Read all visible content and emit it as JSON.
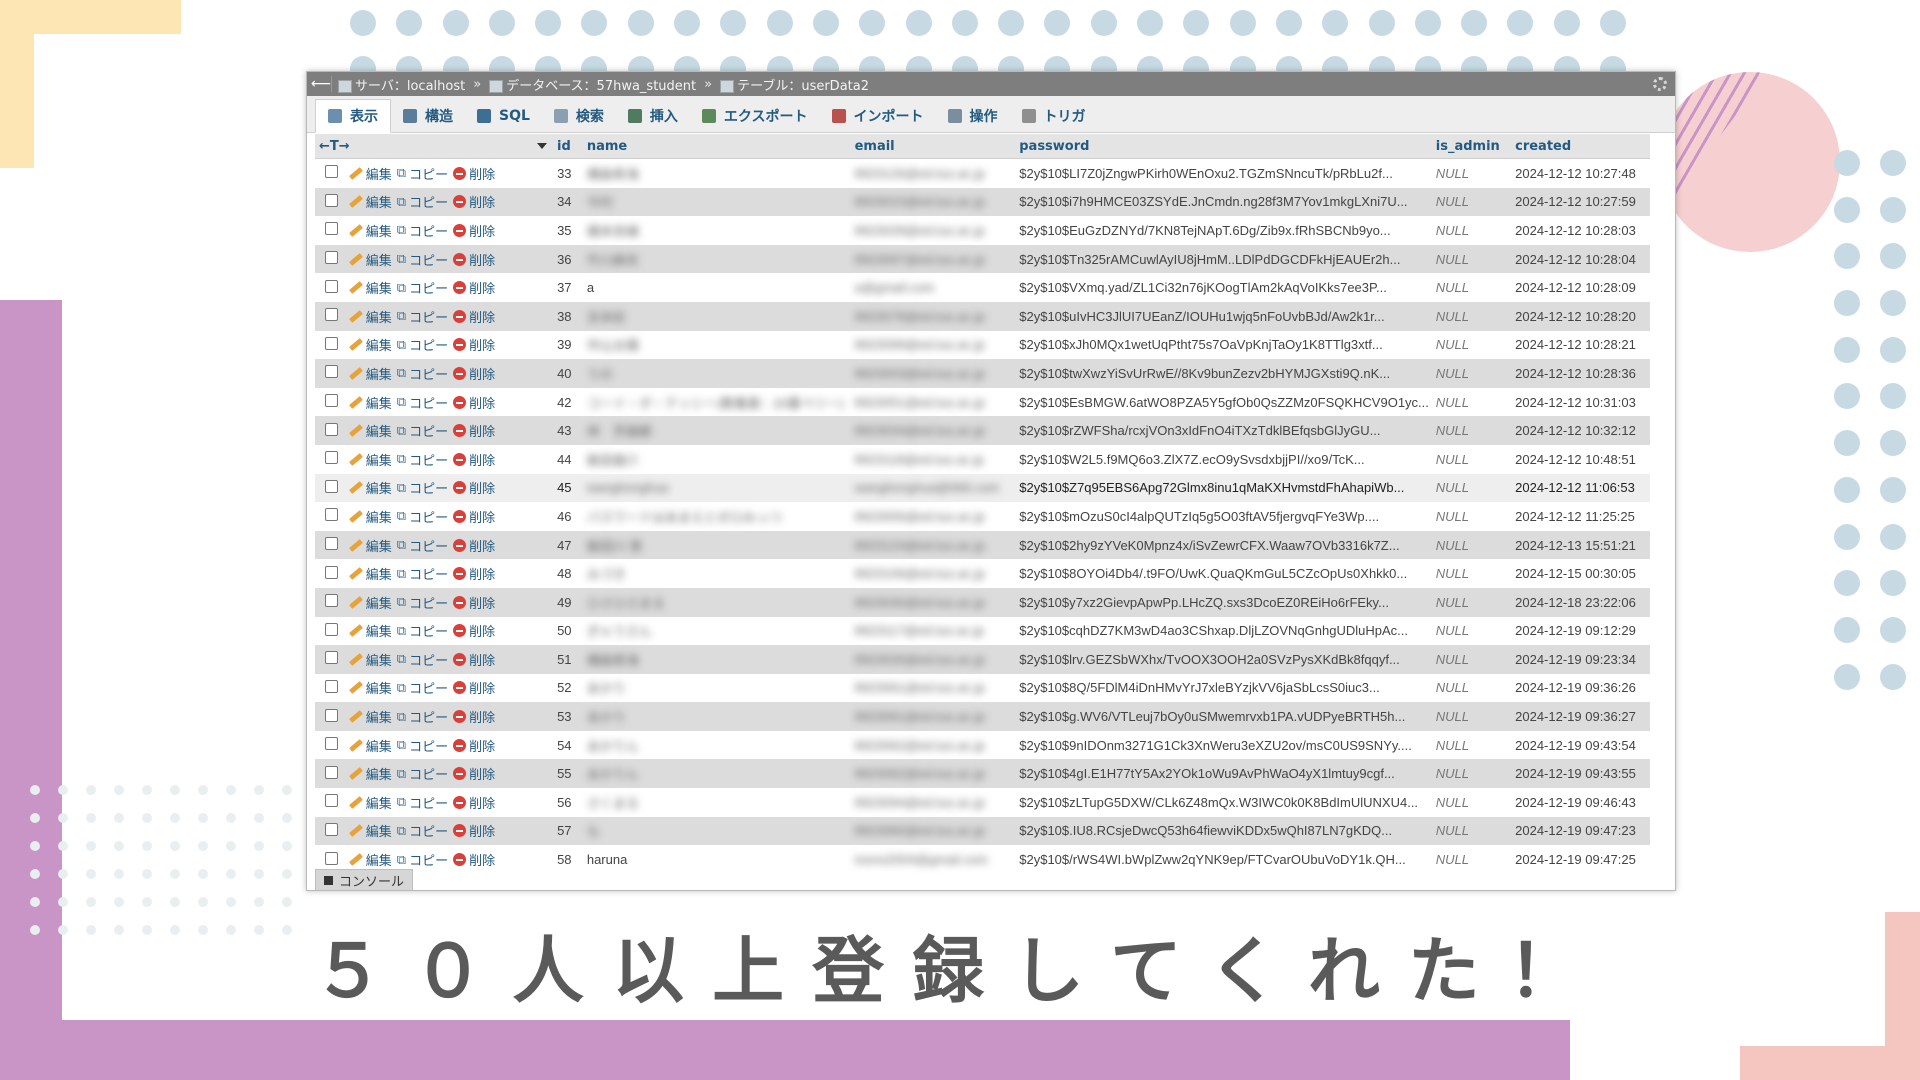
{
  "caption": "５０人以上登録してくれた！",
  "breadcrumb": {
    "server": "サーバ：localhost",
    "database": "データベース：57hwa_student",
    "table": "テーブル：userData2",
    "separator": "»"
  },
  "tabs": [
    {
      "label": "表示",
      "icon": "browse-icon",
      "active": true
    },
    {
      "label": "構造",
      "icon": "structure-icon"
    },
    {
      "label": "SQL",
      "icon": "sql-icon"
    },
    {
      "label": "検索",
      "icon": "search-icon"
    },
    {
      "label": "挿入",
      "icon": "insert-icon"
    },
    {
      "label": "エクスポート",
      "icon": "export-icon"
    },
    {
      "label": "インポート",
      "icon": "import-icon"
    },
    {
      "label": "操作",
      "icon": "operations-icon"
    },
    {
      "label": "トリガ",
      "icon": "triggers-icon"
    }
  ],
  "grid": {
    "arrows": "←T→",
    "columns": [
      "id",
      "name",
      "email",
      "password",
      "is_admin",
      "created"
    ],
    "actions": {
      "edit": "編集",
      "copy": "コピー",
      "delete": "削除"
    },
    "rows": [
      {
        "id": "33",
        "name": "横森希海",
        "email": "8923126@ed.tus.ac.jp",
        "password": "$2y$10$LI7Z0jZngwPKirh0WEnOxu2.TGZmSNncuTk/pRbLu2f...",
        "is_admin": "NULL",
        "created": "2024-12-12 10:27:48"
      },
      {
        "id": "34",
        "name": "今村",
        "email": "8923015@ed.tus.ac.jp",
        "password": "$2y$10$i7h9HMCE03ZSYdE.JnCmdn.ng28f3M7Yov1mkgLXni7U...",
        "is_admin": "NULL",
        "created": "2024-12-12 10:27:59"
      },
      {
        "id": "35",
        "name": "橋本奈緒",
        "email": "8923028@ed.tus.ac.jp",
        "password": "$2y$10$EuGzDZNYd/7KN8TejNApT.6Dg/Zib9x.fRhSBCNb9yo...",
        "is_admin": "NULL",
        "created": "2024-12-12 10:28:03"
      },
      {
        "id": "36",
        "name": "竹川麻衣",
        "email": "8923097@ed.tus.ac.jp",
        "password": "$2y$10$Tn325rAMCuwlAyIU8jHmM..LDlPdDGCDFkHjEAUEr2h...",
        "is_admin": "NULL",
        "created": "2024-12-12 10:28:04"
      },
      {
        "id": "37",
        "name": "a",
        "email": "a@gmail.com",
        "password": "$2y$10$VXmq.yad/ZL1Ci32n76jKOogTlAm2kAqVoIKks7ee3P...",
        "is_admin": "NULL",
        "created": "2024-12-12 10:28:09"
      },
      {
        "id": "38",
        "name": "吉本彩",
        "email": "8923078@ed.tus.ac.jp",
        "password": "$2y$10$uIvHC3JlUI7UEanZ/IOUHu1wjq5nFoUvbBJd/Aw2k1r...",
        "is_admin": "NULL",
        "created": "2024-12-12 10:28:20"
      },
      {
        "id": "39",
        "name": "中山太陽",
        "email": "8923099@ed.tus.ac.jp",
        "password": "$2y$10$xJh0MQx1wetUqPtht75s7OaVpKnjTaOy1K8TTlg3xtf...",
        "is_admin": "NULL",
        "created": "2024-12-12 10:28:21"
      },
      {
        "id": "40",
        "name": "うの",
        "email": "8923003@ed.tus.ac.jp",
        "password": "$2y$10$twXwzYiSvUrRwE//8Kv9bunZezv2bHYMJGXsti9Q.nK...",
        "is_admin": "NULL",
        "created": "2024-12-12 10:28:36"
      },
      {
        "id": "42",
        "name": "コーイ・ボ・テッシー(教養基：20番ペリー)",
        "email": "8923051@ed.tus.ac.jp",
        "password": "$2y$10$EsBMGW.6atWO8PZA5Y5gfOb0QsZZMz0FSQKHCV9O1yc...",
        "is_admin": "NULL",
        "created": "2024-12-12 10:31:03"
      },
      {
        "id": "43",
        "name": "林　芳雄都",
        "email": "8923034@ed.tus.ac.jp",
        "password": "$2y$10$rZWFSha/rcxjVOn3xIdFnO4iTXzTdklBEfqsbGlJyGU...",
        "is_admin": "NULL",
        "created": "2024-12-12 10:32:12"
      },
      {
        "id": "44",
        "name": "飯田雄介",
        "email": "8923118@ed.tus.ac.jp",
        "password": "$2y$10$W2L5.f9MQ6o3.ZlX7Z.ecO9ySvsdxbjjPI//xo9/TcK...",
        "is_admin": "NULL",
        "created": "2024-12-12 10:48:51"
      },
      {
        "id": "45",
        "name": "wanghonghua",
        "email": "wanghonghua@666.com",
        "password": "$2y$10$Z7q95EBS6Apg72Glmx8inu1qMaKXHvmstdFhAhapiWb...",
        "is_admin": "NULL",
        "created": "2024-12-12 11:06:53"
      },
      {
        "id": "46",
        "name": "パスワードはあまえとぜロみっつ",
        "email": "8923006@ed.tus.ac.jp",
        "password": "$2y$10$mOzuS0cI4alpQUTzIq5g5O03ftAV5fjergvqFYe3Wp....",
        "is_admin": "NULL",
        "created": "2024-12-12 11:25:25"
      },
      {
        "id": "47",
        "name": "飯田川 恵",
        "email": "8923124@ed.tus.ac.jp",
        "password": "$2y$10$2hy9zYVeK0Mpnz4x/iSvZewrCFX.Waaw7OVb3316k7Z...",
        "is_admin": "NULL",
        "created": "2024-12-13 15:51:21"
      },
      {
        "id": "48",
        "name": "みづき",
        "email": "8923106@ed.tus.ac.jp",
        "password": "$2y$10$8OYOi4Db4/.t9FO/UwK.QuaQKmGuL5CZcOpUs0Xhkk0...",
        "is_admin": "NULL",
        "created": "2024-12-15 00:30:05"
      },
      {
        "id": "49",
        "name": "ひさひさまる",
        "email": "8923030@ed.tus.ac.jp",
        "password": "$2y$10$y7xz2GievpApwPp.LHcZQ.sxs3DcoEZ0REiHo6rFEky...",
        "is_admin": "NULL",
        "created": "2024-12-18 23:22:06"
      },
      {
        "id": "50",
        "name": "ぎゃうさん",
        "email": "8923117@ed.tus.ac.jp",
        "password": "$2y$10$cqhDZ7KM3wD4ao3CShxap.DljLZOVNqGnhgUDluHpAc...",
        "is_admin": "NULL",
        "created": "2024-12-19 09:12:29"
      },
      {
        "id": "51",
        "name": "横森希海",
        "email": "8923026@ed.tus.ac.jp",
        "password": "$2y$10$lrv.GEZSbWXhx/TvOOX3OOH2a0SVzPysXKdBk8fqqyf...",
        "is_admin": "NULL",
        "created": "2024-12-19 09:23:34"
      },
      {
        "id": "52",
        "name": "あかり",
        "email": "8923061@ed.tus.ac.jp",
        "password": "$2y$10$8Q/5FDlM4iDnHMvYrJ7xleBYzjkVV6jaSbLcsS0iuc3...",
        "is_admin": "NULL",
        "created": "2024-12-19 09:36:26"
      },
      {
        "id": "53",
        "name": "あかり",
        "email": "8923061@ed.tus.ac.jp",
        "password": "$2y$10$g.WV6/VTLeuj7bOy0uSMwemrvxb1PA.vUDPyeBRTH5h...",
        "is_admin": "NULL",
        "created": "2024-12-19 09:36:27"
      },
      {
        "id": "54",
        "name": "あかりん",
        "email": "8923062@ed.tus.ac.jp",
        "password": "$2y$10$9nIDOnm3271G1Ck3XnWeru3eXZU2ov/msC0US9SNYy....",
        "is_admin": "NULL",
        "created": "2024-12-19 09:43:54"
      },
      {
        "id": "55",
        "name": "あかりん",
        "email": "8923062@ed.tus.ac.jp",
        "password": "$2y$10$4gI.E1H77tY5Ax2YOk1oWu9AvPhWaO4yX1lmtuy9cgf...",
        "is_admin": "NULL",
        "created": "2024-12-19 09:43:55"
      },
      {
        "id": "56",
        "name": "さくまる",
        "email": "8923094@ed.tus.ac.jp",
        "password": "$2y$10$zLTupG5DXW/CLk6Z48mQx.W3IWC0k0K8BdImUlUNXU4...",
        "is_admin": "NULL",
        "created": "2024-12-19 09:46:43"
      },
      {
        "id": "57",
        "name": "も",
        "email": "8923060@ed.tus.ac.jp",
        "password": "$2y$10$.IU8.RCsjeDwcQ53h64fiewviKDDx5wQhI87LN7gKDQ...",
        "is_admin": "NULL",
        "created": "2024-12-19 09:47:23"
      },
      {
        "id": "58",
        "name": "haruna",
        "email": "inono2004@gmail.com",
        "password": "$2y$10$/rWS4WI.bWplZww2qYNK9ep/FTCvarOUbuVoDY1k.QH...",
        "is_admin": "NULL",
        "created": "2024-12-19 09:47:25"
      }
    ]
  },
  "console": "コンソール",
  "colors": {
    "accent": "#235a81",
    "dots": "#c7dae3",
    "purple": "#c994c6",
    "peach": "#f5c6c0",
    "yellow": "#fde6b4"
  }
}
